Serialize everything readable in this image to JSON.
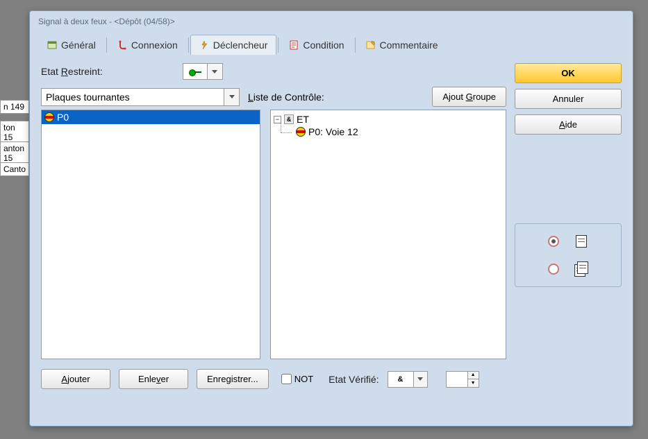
{
  "background_items": [
    "n 149",
    "ton 15",
    "anton 15",
    "Canto"
  ],
  "dialog": {
    "title": "Signal à deux feux - <Dépôt (04/58)>",
    "tabs": [
      {
        "label": "Général",
        "icon": "general-icon"
      },
      {
        "label": "Connexion",
        "icon": "connection-icon"
      },
      {
        "label": "Déclencheur",
        "icon": "trigger-icon",
        "active": true
      },
      {
        "label": "Condition",
        "icon": "condition-icon"
      },
      {
        "label": "Commentaire",
        "icon": "comment-icon"
      }
    ],
    "labels": {
      "restricted_state_prefix": "Etat ",
      "restricted_state_u": "R",
      "restricted_state_rest": "estreint:",
      "category_value": "Plaques tournantes",
      "control_list_prefix": "",
      "control_list_u": "L",
      "control_list_rest": "iste de Contrôle:",
      "add_group_prefix": "Ajout ",
      "add_group_u": "G",
      "add_group_rest": "roupe"
    },
    "left_list": [
      {
        "label": "P0"
      }
    ],
    "tree": {
      "root": {
        "op": "&",
        "label": "ET"
      },
      "children": [
        {
          "label": "P0: Voie 12"
        }
      ]
    },
    "bottom": {
      "add_u": "A",
      "add_rest": "jouter",
      "remove_prefix": "Enle",
      "remove_u": "v",
      "remove_rest": "er",
      "save": "Enregistrer...",
      "not_label": "NOT",
      "verified_label": "Etat Vérifié:",
      "verified_value": "&"
    }
  },
  "buttons": {
    "ok": "OK",
    "cancel": "Annuler",
    "help_u": "A",
    "help_rest": "ide"
  }
}
